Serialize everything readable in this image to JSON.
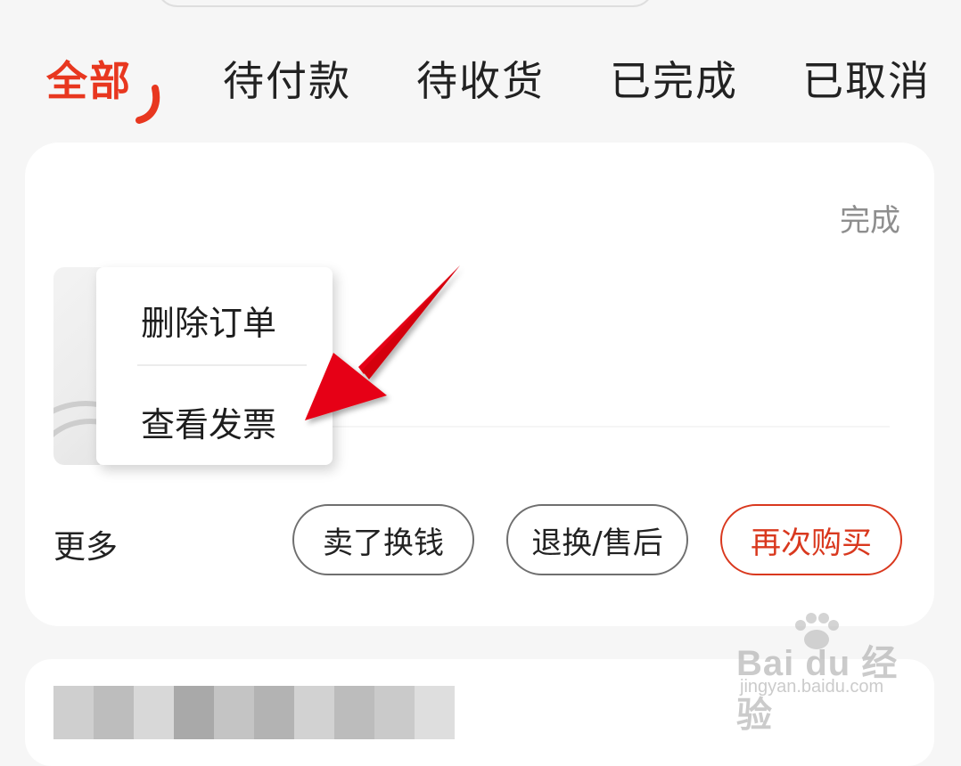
{
  "tabs": [
    {
      "label": "全部",
      "active": true
    },
    {
      "label": "待付款",
      "active": false
    },
    {
      "label": "待收货",
      "active": false
    },
    {
      "label": "已完成",
      "active": false
    },
    {
      "label": "已取消",
      "active": false
    }
  ],
  "order": {
    "status": "完成",
    "more_label": "更多",
    "buttons": {
      "sell": "卖了换钱",
      "return": "退换/售后",
      "rebuy": "再次购买"
    }
  },
  "popup_menu": {
    "items": [
      "删除订单",
      "查看发票"
    ]
  },
  "watermark": {
    "brand": "Bai du 经验",
    "url": "jingyan.baidu.com"
  },
  "colors": {
    "accent": "#e8371f",
    "arrow": "#e60012",
    "muted": "#8e8e8e",
    "background": "#f6f6f6"
  },
  "icons": [
    "tab-underline-icon",
    "red-arrow-icon",
    "baidu-paw-icon"
  ]
}
